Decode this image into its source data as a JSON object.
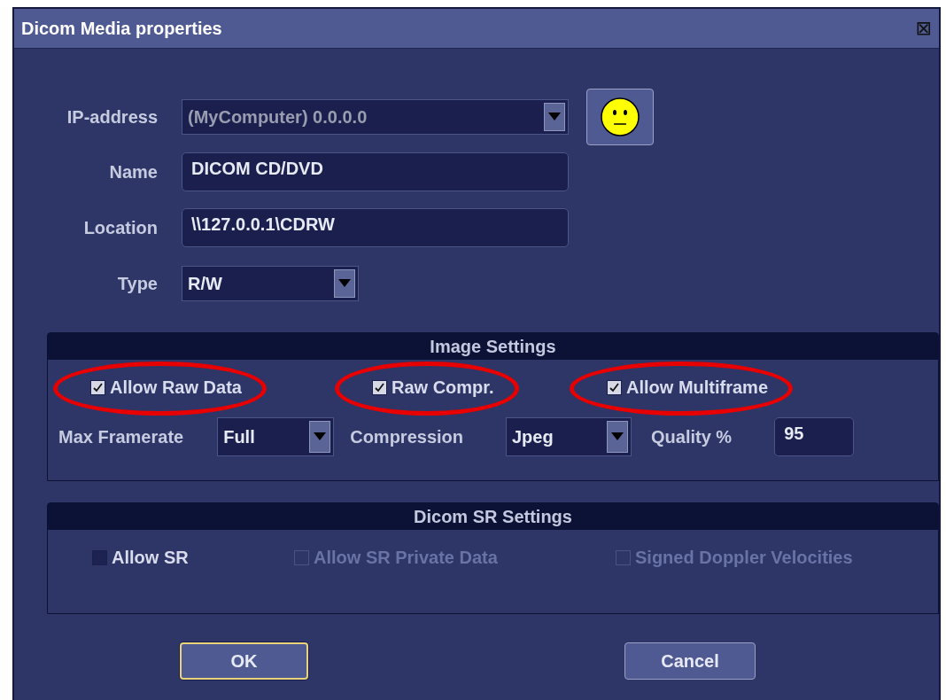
{
  "window": {
    "title": "Dicom Media properties",
    "close_symbol": "⊠"
  },
  "form": [
    {
      "kind": "dropdown",
      "label": "IP-address",
      "value": "(MyComputer) 0.0.0.0",
      "disabled": true,
      "wide": true
    },
    {
      "kind": "text",
      "label": "Name",
      "value": "DICOM CD/DVD"
    },
    {
      "kind": "text",
      "label": "Location",
      "value": "\\\\127.0.0.1\\CDRW"
    },
    {
      "kind": "dropdown",
      "label": "Type",
      "value": "R/W",
      "disabled": false,
      "wide": false
    }
  ],
  "image_settings": {
    "title": "Image Settings",
    "checkboxes": [
      {
        "label": "Allow Raw Data",
        "checked": true,
        "highlighted": true
      },
      {
        "label": "Raw Compr.",
        "checked": true,
        "highlighted": true
      },
      {
        "label": "Allow Multiframe",
        "checked": true,
        "highlighted": true
      }
    ],
    "controls": [
      {
        "kind": "dropdown",
        "label": "Max Framerate",
        "value": "Full"
      },
      {
        "kind": "dropdown",
        "label": "Compression",
        "value": "Jpeg"
      },
      {
        "kind": "text",
        "label": "Quality %",
        "value": "95"
      }
    ]
  },
  "sr_settings": {
    "title": "Dicom SR Settings",
    "checkboxes": [
      {
        "label": "Allow SR",
        "checked": false,
        "disabled": false
      },
      {
        "label": "Allow SR Private Data",
        "checked": false,
        "disabled": true
      },
      {
        "label": "Signed Doppler Velocities",
        "checked": false,
        "disabled": true
      }
    ]
  },
  "buttons": [
    {
      "label": "OK",
      "focused": true
    },
    {
      "label": "Cancel",
      "focused": false
    }
  ]
}
